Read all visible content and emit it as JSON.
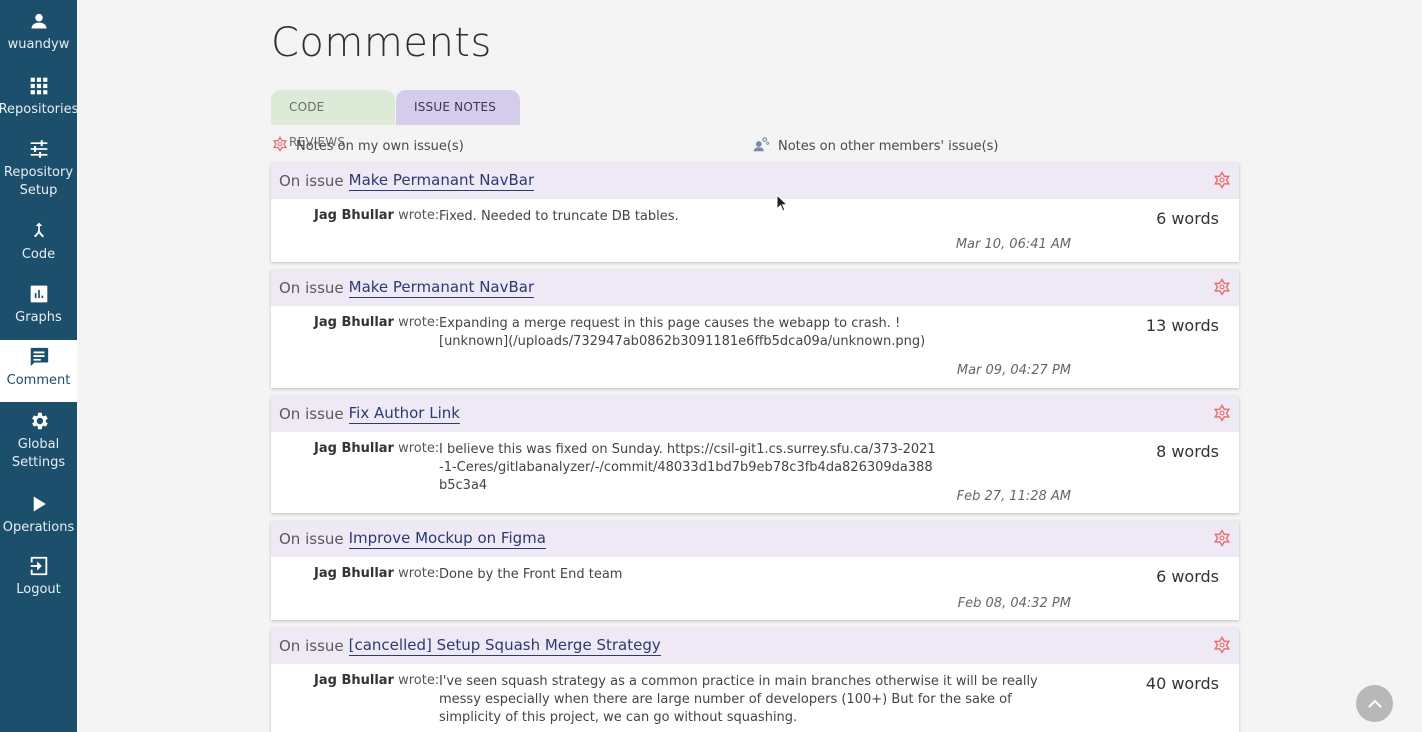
{
  "sidebar": {
    "items": [
      {
        "label": "wuandyw",
        "icon": "person-icon"
      },
      {
        "label": "Repositories",
        "icon": "grid-icon"
      },
      {
        "label": "Repository Setup",
        "icon": "sliders-icon"
      },
      {
        "label": "Code",
        "icon": "merge-icon"
      },
      {
        "label": "Graphs",
        "icon": "bar-chart-icon"
      },
      {
        "label": "Comment",
        "icon": "comment-icon"
      },
      {
        "label": "Global Settings",
        "icon": "gear-icon"
      },
      {
        "label": "Operations",
        "icon": "play-icon"
      },
      {
        "label": "Logout",
        "icon": "logout-icon"
      }
    ]
  },
  "page": {
    "title": "Comments"
  },
  "tabs": {
    "code_reviews": "CODE REVIEWS",
    "issue_notes": "ISSUE NOTES"
  },
  "legend": {
    "own": "Notes on my own issue(s)",
    "other": "Notes on other members' issue(s)"
  },
  "colors": {
    "sidebar": "#1c4f6b",
    "header_bg": "#efe9f6",
    "star": "#e57373",
    "issue_tab": "#d5cbea",
    "code_tab": "#dcebd8"
  },
  "notes": [
    {
      "prefix": "On issue",
      "issue": "Make Permanant NavBar",
      "author": "Jag Bhullar",
      "wrote": "wrote:",
      "text": "Fixed. Needed to truncate DB tables.",
      "words": "6 words",
      "timestamp": "Mar 10, 06:41 AM"
    },
    {
      "prefix": "On issue",
      "issue": "Make Permanant NavBar",
      "author": "Jag Bhullar",
      "wrote": "wrote:",
      "text": "Expanding a merge request in this page causes the webapp to crash. ![unknown](/uploads/732947ab0862b3091181e6ffb5dca09a/unknown.png)",
      "words": "13 words",
      "timestamp": "Mar 09, 04:27 PM"
    },
    {
      "prefix": "On issue",
      "issue": "Fix Author Link",
      "author": "Jag Bhullar",
      "wrote": "wrote:",
      "text": "I believe this was fixed on Sunday. https://csil-git1.cs.surrey.sfu.ca/373-2021-1-Ceres/gitlabanalyzer/-/commit/48033d1bd7b9eb78c3fb4da826309da388b5c3a4",
      "words": "8 words",
      "timestamp": "Feb 27, 11:28 AM"
    },
    {
      "prefix": "On issue",
      "issue": "Improve Mockup on Figma",
      "author": "Jag Bhullar",
      "wrote": "wrote:",
      "text": "Done by the Front End team",
      "words": "6 words",
      "timestamp": "Feb 08, 04:32 PM"
    },
    {
      "prefix": "On issue",
      "issue": "[cancelled] Setup Squash Merge Strategy",
      "author": "Jag Bhullar",
      "wrote": "wrote:",
      "text": "I've seen squash strategy as a common practice in main branches otherwise it will be really messy especially when there are large number of developers (100+) But for the sake of simplicity of this project, we can go without squashing.",
      "words": "40 words",
      "timestamp": ""
    }
  ],
  "scroll_top": "^"
}
